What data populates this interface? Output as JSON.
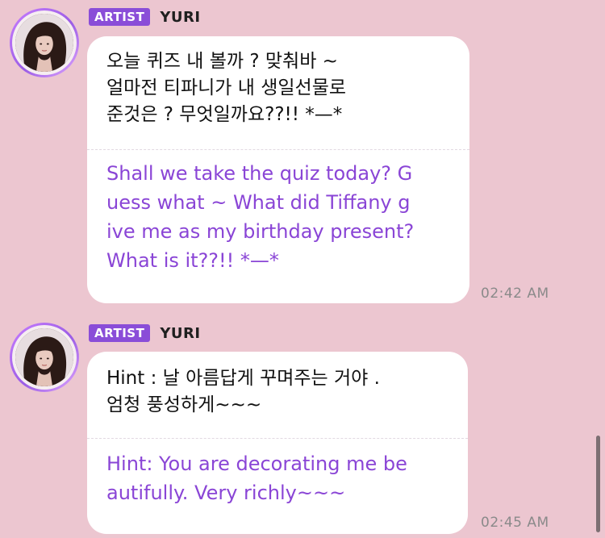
{
  "messages": [
    {
      "badge": "ARTIST",
      "username": "YURI",
      "original": "오늘 퀴즈  내 볼까 ? 맞춰바 ~\n얼마전 티파니가 내 생일선물로\n준것은 ? 무엇일까요??!! *—*",
      "translation": "Shall we take the quiz today? G\nuess what ~ What did Tiffany g\nive me as my birthday present?\n What is it??!! *—*",
      "time": "02:42 AM"
    },
    {
      "badge": "ARTIST",
      "username": "YURI",
      "original": "Hint : 날 아름답게 꾸며주는 거야 .\n엄청 풍성하게~~~",
      "translation": "Hint: You are decorating me be\nautifully. Very richly~~~",
      "time": "02:45 AM"
    }
  ],
  "colors": {
    "background": "#ecc6d0",
    "badge": "#8a4dd8",
    "translation_text": "#8a45d6",
    "bubble": "#ffffff"
  },
  "icons": {
    "avatar": "profile-photo"
  }
}
